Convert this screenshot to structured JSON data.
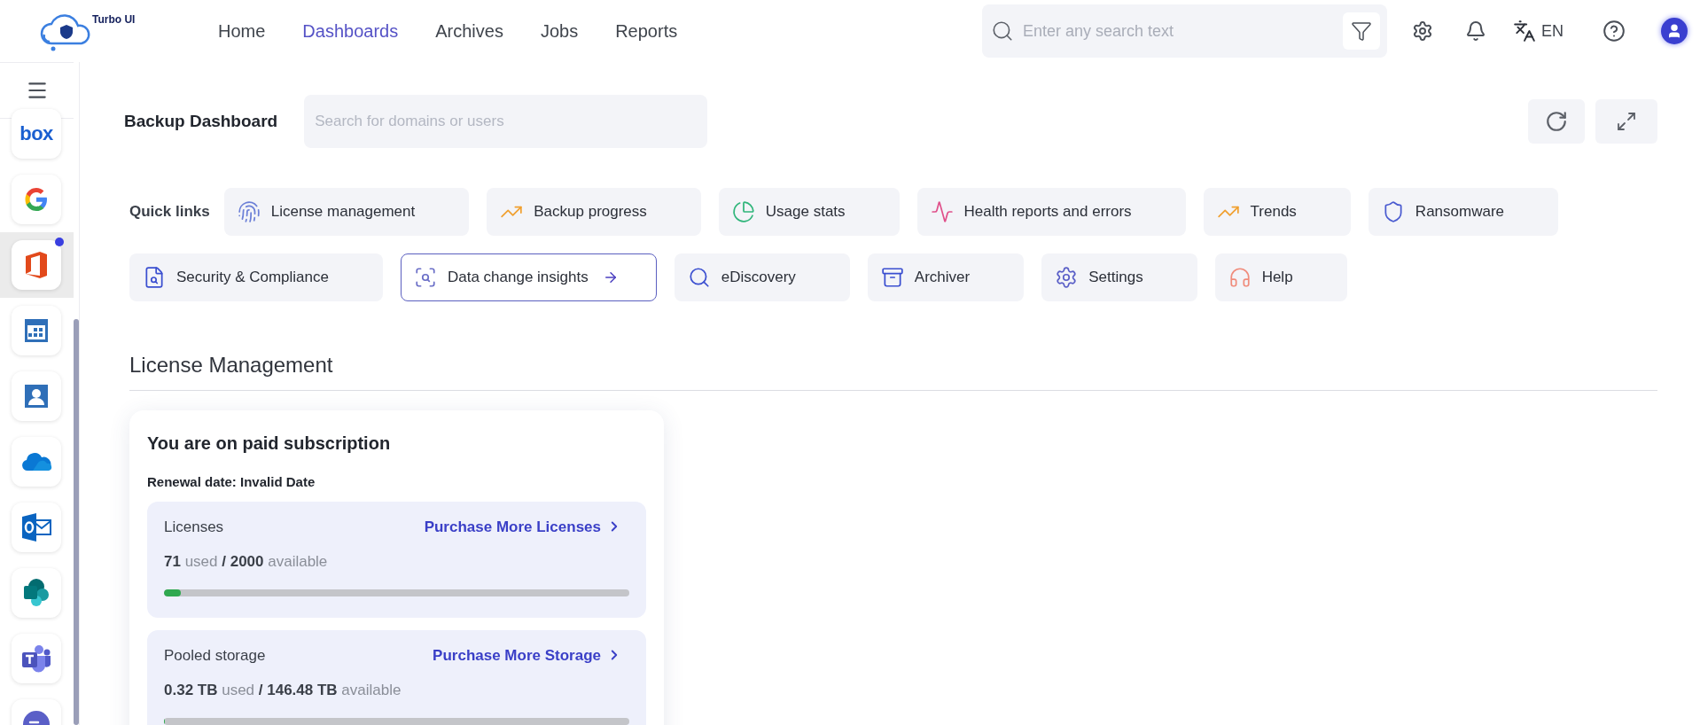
{
  "header": {
    "logo_text": "Turbo UI",
    "nav": [
      {
        "label": "Home",
        "selected": false
      },
      {
        "label": "Dashboards",
        "selected": true
      },
      {
        "label": "Archives",
        "selected": false
      },
      {
        "label": "Jobs",
        "selected": false
      },
      {
        "label": "Reports",
        "selected": false
      }
    ],
    "search": {
      "placeholder": "Enter any search text"
    },
    "language": "EN"
  },
  "sidebar": {
    "items": [
      {
        "kind": "box",
        "label": "box",
        "selected": false,
        "badge": false
      },
      {
        "kind": "google",
        "selected": false,
        "badge": false
      },
      {
        "kind": "office",
        "selected": true,
        "badge": true
      },
      {
        "kind": "calendar",
        "selected": false,
        "badge": false
      },
      {
        "kind": "contacts",
        "selected": false,
        "badge": false
      },
      {
        "kind": "onedrive",
        "selected": false,
        "badge": false
      },
      {
        "kind": "outlook",
        "selected": false,
        "badge": false
      },
      {
        "kind": "sharepoint",
        "selected": false,
        "badge": false
      },
      {
        "kind": "teams",
        "selected": false,
        "badge": false
      },
      {
        "kind": "chat",
        "selected": false,
        "badge": false
      }
    ]
  },
  "page": {
    "title": "Backup Dashboard",
    "search": {
      "placeholder": "Search for domains or users"
    }
  },
  "quick_links": {
    "label": "Quick links",
    "items": [
      {
        "kind": "license",
        "label": "License management",
        "selected": false
      },
      {
        "kind": "progress",
        "label": "Backup progress",
        "selected": false
      },
      {
        "kind": "usage",
        "label": "Usage stats",
        "selected": false
      },
      {
        "kind": "health",
        "label": "Health reports and errors",
        "selected": false
      },
      {
        "kind": "trends",
        "label": "Trends",
        "selected": false
      },
      {
        "kind": "ransomware",
        "label": "Ransomware",
        "selected": false
      },
      {
        "kind": "security",
        "label": "Security & Compliance",
        "selected": false
      },
      {
        "kind": "insights",
        "label": "Data change insights",
        "selected": true
      },
      {
        "kind": "ediscovery",
        "label": "eDiscovery",
        "selected": false
      },
      {
        "kind": "archiver",
        "label": "Archiver",
        "selected": false
      },
      {
        "kind": "settings",
        "label": "Settings",
        "selected": false
      },
      {
        "kind": "help",
        "label": "Help",
        "selected": false
      }
    ]
  },
  "license_management": {
    "heading": "License Management",
    "card": {
      "title": "You are on paid subscription",
      "renewal": "Renewal date: Invalid Date",
      "sections": [
        {
          "name": "Licenses",
          "link": "Purchase More Licenses",
          "usage": "**71** used **/ 2000** available",
          "level": 0.036
        },
        {
          "name": "Pooled storage",
          "link": "Purchase More Storage",
          "usage": "**0.32 TB** used **/ 146.48 TB** available",
          "level": 0.002
        }
      ]
    }
  }
}
